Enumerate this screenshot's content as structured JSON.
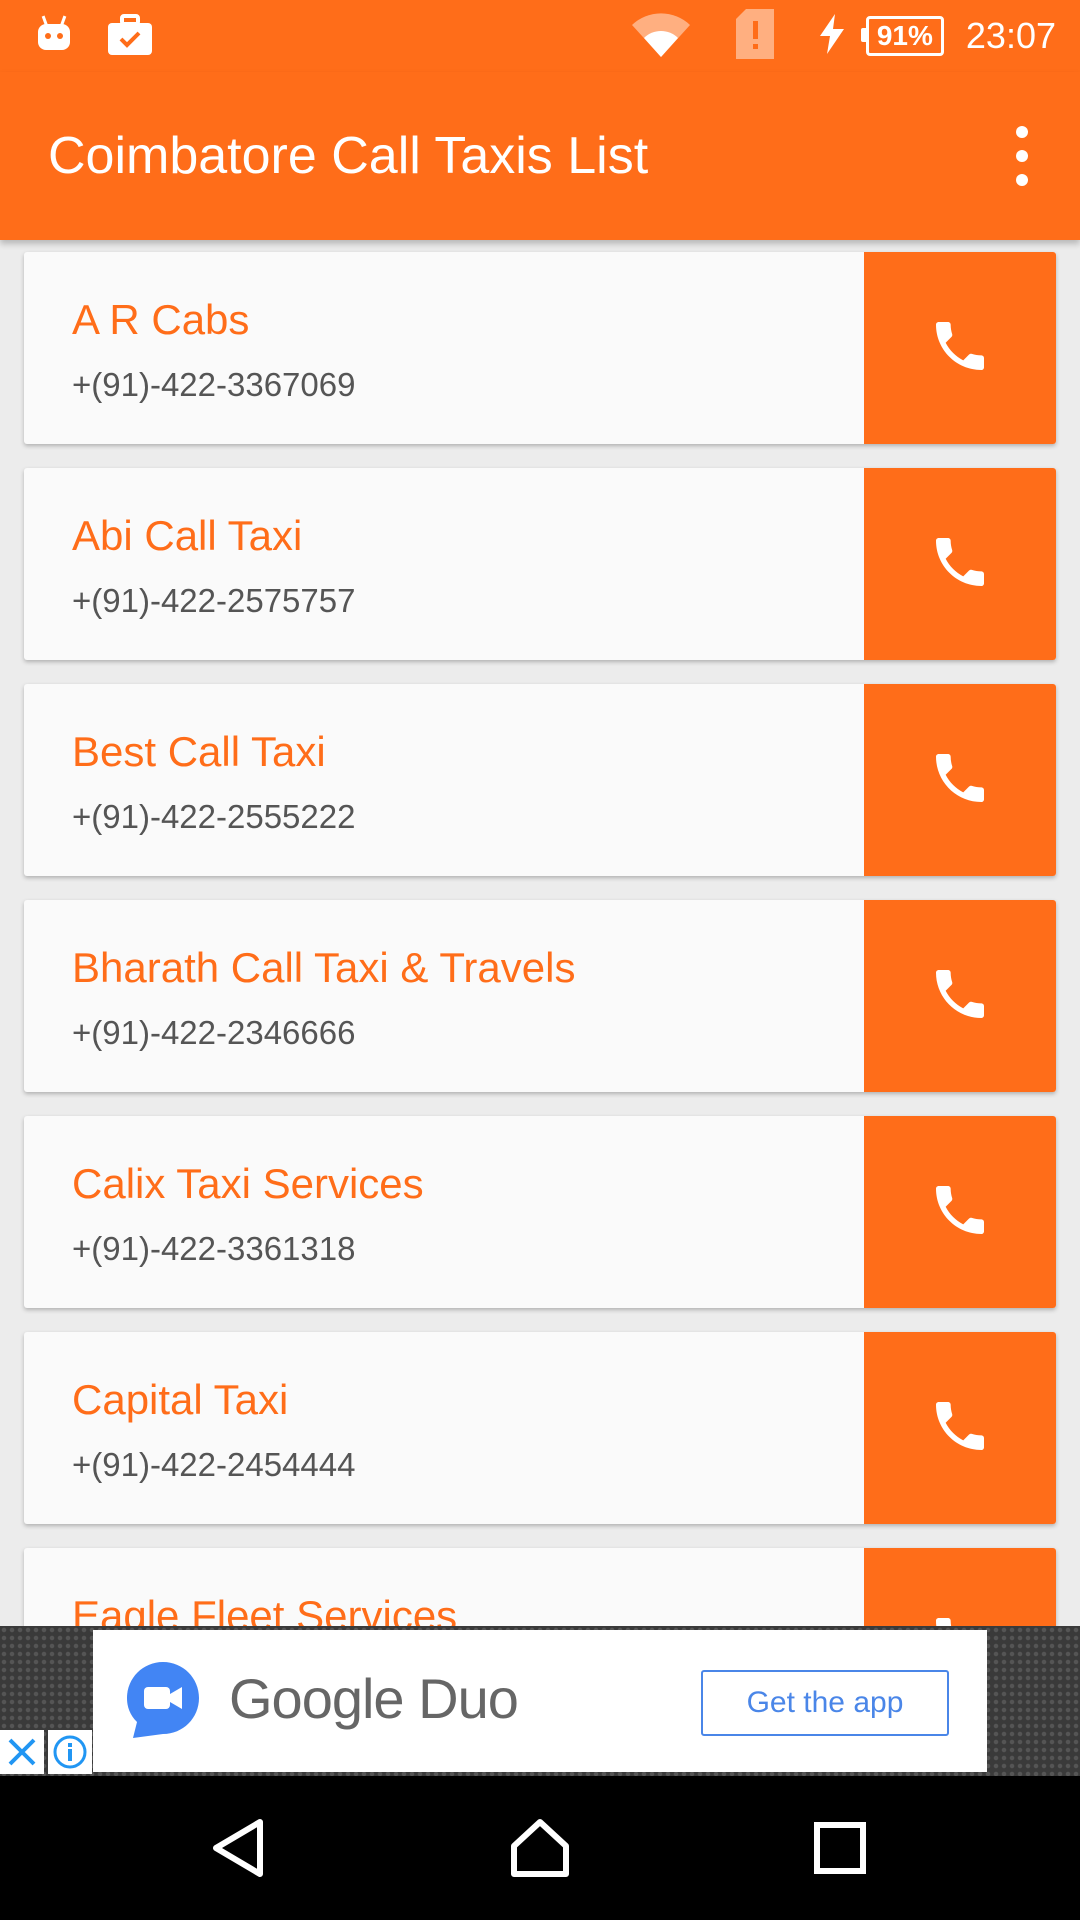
{
  "status_bar": {
    "time": "23:07",
    "battery": "91%",
    "icons": [
      "android-icon",
      "briefcase-check-icon",
      "wifi-icon",
      "sim-alert-icon",
      "charging-icon"
    ]
  },
  "app_bar": {
    "title": "Coimbatore Call Taxis List",
    "menu_icon": "more-vert-icon"
  },
  "taxis": [
    {
      "name": "A R Cabs",
      "phone": "+(91)-422-3367069"
    },
    {
      "name": "Abi Call Taxi",
      "phone": "+(91)-422-2575757"
    },
    {
      "name": "Best Call Taxi",
      "phone": "+(91)-422-2555222"
    },
    {
      "name": "Bharath Call Taxi & Travels",
      "phone": "+(91)-422-2346666"
    },
    {
      "name": "Calix Taxi Services",
      "phone": "+(91)-422-3361318"
    },
    {
      "name": "Capital Taxi",
      "phone": "+(91)-422-2454444"
    },
    {
      "name": "Eagle Fleet Services",
      "phone": ""
    }
  ],
  "ad": {
    "title": "Google Duo",
    "cta": "Get the app"
  },
  "colors": {
    "accent": "#ff6d19",
    "phone_text": "#555555",
    "ad_cta": "#4a86e8"
  }
}
